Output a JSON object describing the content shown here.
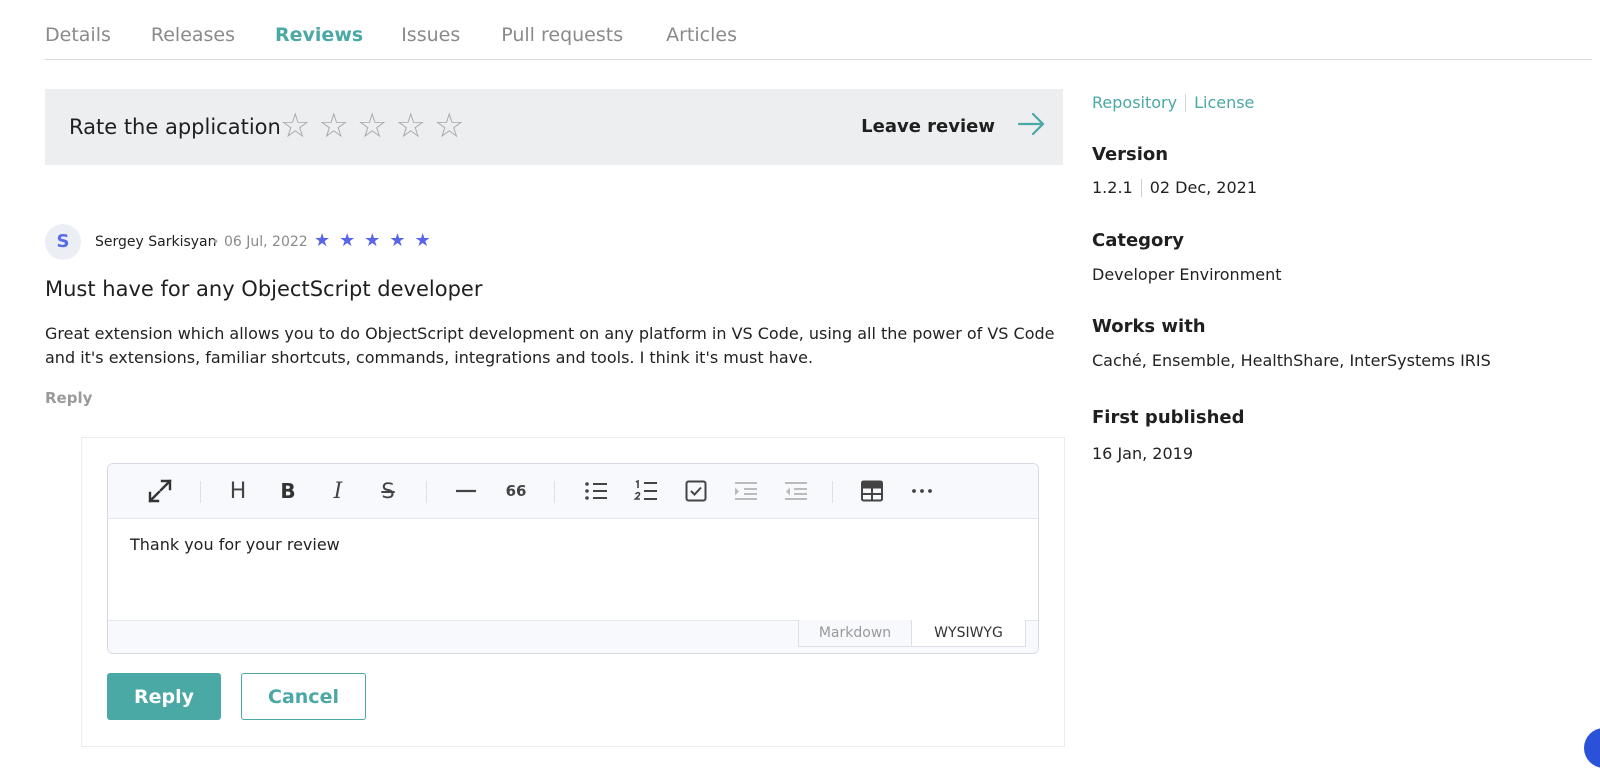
{
  "tabs": [
    {
      "label": "Details",
      "active": false
    },
    {
      "label": "Releases",
      "active": false
    },
    {
      "label": "Reviews",
      "active": true
    },
    {
      "label": "Issues",
      "active": false
    },
    {
      "label": "Pull requests",
      "active": false
    },
    {
      "label": "Articles",
      "active": false
    }
  ],
  "rate": {
    "label": "Rate the application",
    "stars_total": 5,
    "stars_selected": 0,
    "leave_review": "Leave review",
    "star_glyph": "☆",
    "arrow_icon": "arrow-right-icon"
  },
  "review": {
    "avatar_letter": "S",
    "author": "Sergey Sarkisyan",
    "dot": "•",
    "date": "06 Jul, 2022",
    "rating": 5,
    "star_glyph": "★",
    "title": "Must have for any ObjectScript developer",
    "body": "Great extension which allows you to do ObjectScript development on any platform in VS Code, using all the power of VS Code and it's extensions, familiar shortcuts, commands, integrations and tools. I think it's must have.",
    "reply_link": "Reply"
  },
  "editor": {
    "toolbar": [
      "expand-icon",
      "heading-icon",
      "bold-icon",
      "italic-icon",
      "strikethrough-icon",
      "horizontal-rule-icon",
      "quote-icon",
      "bullet-list-icon",
      "ordered-list-icon",
      "task-list-icon",
      "indent-icon",
      "outdent-icon",
      "table-icon",
      "more-icon"
    ],
    "heading_glyph": "H",
    "bold_glyph": "B",
    "italic_glyph": "I",
    "strike_glyph": "S",
    "quote_glyph": "66",
    "content": "Thank you for your review",
    "modes": [
      "Markdown",
      "WYSIWYG"
    ],
    "active_mode": "WYSIWYG"
  },
  "actions": {
    "reply": "Reply",
    "cancel": "Cancel"
  },
  "sidebar": {
    "links": [
      "Repository",
      "License"
    ],
    "version_label": "Version",
    "version": "1.2.1",
    "version_date": "02 Dec, 2021",
    "category_label": "Category",
    "category": "Developer Environment",
    "works_with_label": "Works with",
    "works_with": "Caché, Ensemble, HealthShare, InterSystems IRIS",
    "first_published_label": "First published",
    "first_published": "16 Jan, 2019"
  },
  "colors": {
    "accent": "#4aa8a5",
    "star_review": "#5865e8",
    "star_empty": "#a9a9a9",
    "rate_box_bg": "#eceeef"
  }
}
